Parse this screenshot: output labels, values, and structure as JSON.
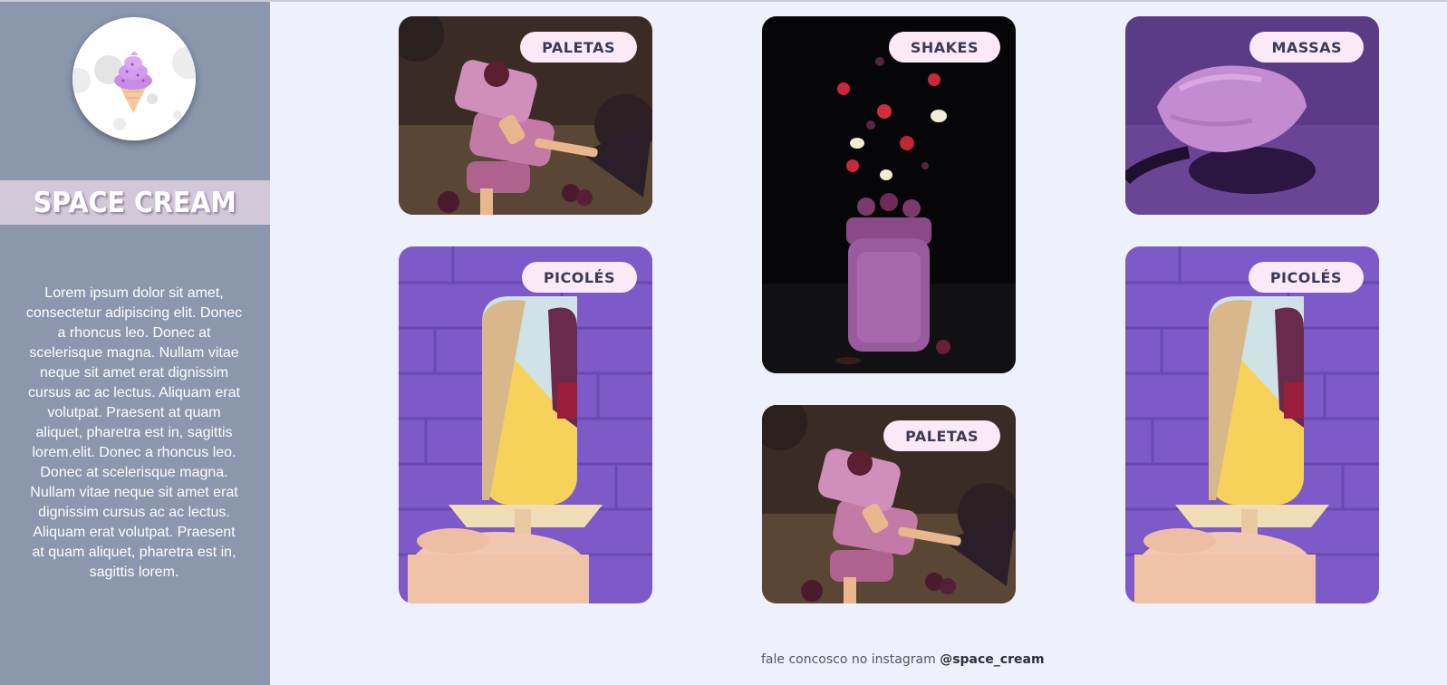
{
  "sidebar": {
    "brand_title": "SPACE CREAM",
    "description": "Lorem ipsum dolor sit amet, consectetur adipiscing elit. Donec a rhoncus leo. Donec at scelerisque magna. Nullam vitae neque sit amet erat dignissim cursus ac ac lectus. Aliquam erat volutpat. Praesent at quam aliquet, pharetra est in, sagittis lorem.elit. Donec a rhoncus leo. Donec at scelerisque magna. Nullam vitae neque sit amet erat dignissim cursus ac ac lectus. Aliquam erat volutpat. Praesent at quam aliquet, pharetra est in, sagittis lorem."
  },
  "gallery": [
    {
      "label": "PALETAS",
      "image": "stacked-popsicles-photo"
    },
    {
      "label": "SHAKES",
      "image": "berry-shake-jar-photo"
    },
    {
      "label": "MASSAS",
      "image": "purple-ice-cream-scoop-photo"
    },
    {
      "label": "PICOLÉS",
      "image": "hand-holding-popsicle-photo"
    },
    {
      "label": "PALETAS",
      "image": "stacked-popsicles-photo"
    },
    {
      "label": "PICOLÉS",
      "image": "hand-holding-popsicle-photo"
    }
  ],
  "footer": {
    "text": "fale concosco no instagram",
    "handle": "@space_cream"
  },
  "colors": {
    "background": "#eef0fc",
    "sidebar": "#8a97ad",
    "brand_band": "#d3c7da",
    "tag_bg": "#fbe9f7",
    "tag_text": "#3b3b58"
  }
}
